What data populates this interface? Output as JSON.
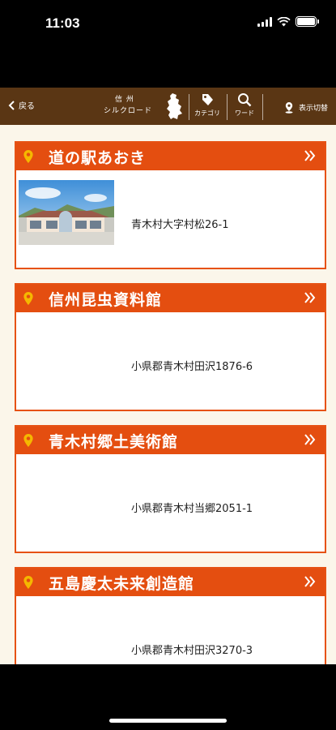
{
  "status_bar": {
    "time": "11:03"
  },
  "nav": {
    "back_label": "戻る",
    "logo_line1": "信 州",
    "logo_line2": "シルクロード",
    "category_label": "カテゴリ",
    "word_label": "ワード",
    "display_toggle_label": "表示切替"
  },
  "spots": [
    {
      "name": "道の駅あおき",
      "address": "青木村大字村松26-1",
      "has_photo": true
    },
    {
      "name": "信州昆虫資料館",
      "address": "小県郡青木村田沢1876-6",
      "has_photo": false
    },
    {
      "name": "青木村郷土美術館",
      "address": "小県郡青木村当郷2051-1",
      "has_photo": false
    },
    {
      "name": "五島慶太未来創造館",
      "address": "小県郡青木村田沢3270-3",
      "has_photo": false
    }
  ],
  "colors": {
    "nav_brown": "#5a3614",
    "accent_orange": "#e44e10",
    "pin_yellow": "#f5b800",
    "background_cream": "#fbf6ea"
  },
  "icons": [
    "chevron-left-icon",
    "tag-icon",
    "search-icon",
    "map-pin-icon",
    "location-pin-icon",
    "double-chevron-right-icon"
  ]
}
